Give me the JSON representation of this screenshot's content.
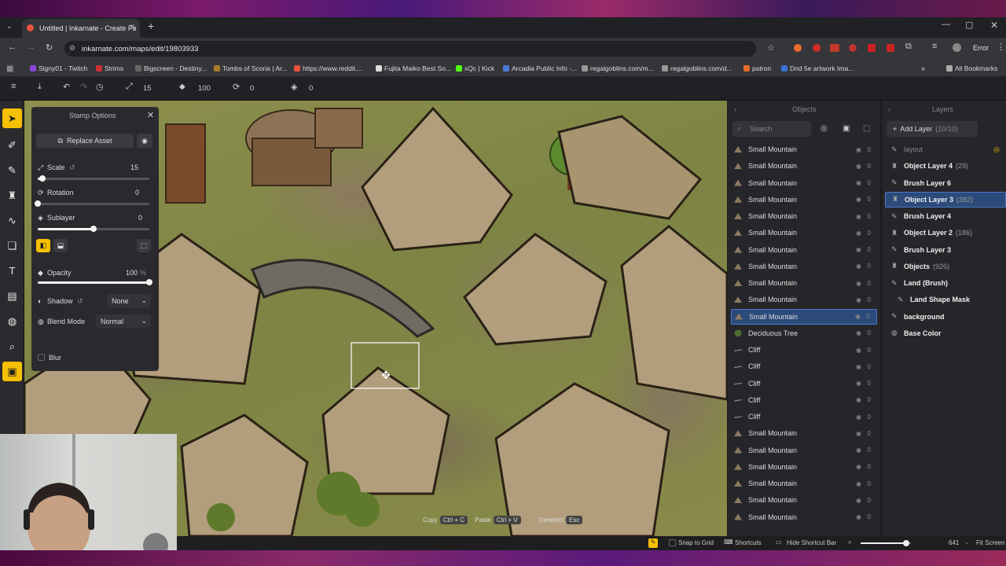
{
  "browser": {
    "tab_title": "Untitled | Inkarnate - Create Fa",
    "url": "inkarnate.com/maps/edit/19803933",
    "profile_label": "Error",
    "bookmarks": [
      "Signy01 - Twitch",
      "Strims",
      "Bigscreen - Destiny...",
      "Tombs of Scoria | Ar...",
      "https://www.reddit....",
      "Fujita Maiko Best So...",
      "xQc | Kick",
      "Arcadia Public Info -...",
      "regalgoblins.com/m...",
      "regalgoblins.com/d...",
      "patron",
      "Dnd 5e artwork Ima..."
    ],
    "all_bookmarks": "All Bookmarks"
  },
  "toolbar": {
    "size_value": "15",
    "opacity_value": "100",
    "rotation_value": "0",
    "layer_value": "0"
  },
  "stamp": {
    "title": "Stamp Options",
    "replace": "Replace Asset",
    "scale_label": "Scale",
    "scale_value": "15",
    "rotation_label": "Rotation",
    "rotation_value": "0",
    "sublayer_label": "Sublayer",
    "sublayer_value": "0",
    "opacity_label": "Opacity",
    "opacity_value": "100",
    "opacity_unit": "%",
    "shadow_label": "Shadow",
    "shadow_value": "None",
    "blend_label": "Blend Mode",
    "blend_value": "Normal",
    "blur_label": "Blur",
    "scale_level": 0.04,
    "rotation_level": 0.0,
    "sublayer_level": 0.5,
    "opacity_level": 1.0
  },
  "shortcuts": {
    "copy": "Copy",
    "copy_key": "Ctrl + C",
    "paste": "Paste",
    "paste_key": "Ctrl + V",
    "deselect": "Deselect",
    "deselect_key": "Esc"
  },
  "status": {
    "snap": "Snap to Grid",
    "shortcuts": "Shortcuts",
    "hide_bar": "Hide Shortcut Bar",
    "zoom": "641",
    "fit": "Fit Screen"
  },
  "objects": {
    "title": "Objects",
    "search_placeholder": "Search",
    "items": [
      {
        "name": "Small Mountain",
        "kind": "mountain",
        "value": "0"
      },
      {
        "name": "Small Mountain",
        "kind": "mountain",
        "value": "0"
      },
      {
        "name": "Small Mountain",
        "kind": "mountain",
        "value": "0"
      },
      {
        "name": "Small Mountain",
        "kind": "mountain",
        "value": "0"
      },
      {
        "name": "Small Mountain",
        "kind": "mountain",
        "value": "0"
      },
      {
        "name": "Small Mountain",
        "kind": "mountain",
        "value": "0"
      },
      {
        "name": "Small Mountain",
        "kind": "mountain",
        "value": "0"
      },
      {
        "name": "Small Mountain",
        "kind": "mountain",
        "value": "0"
      },
      {
        "name": "Small Mountain",
        "kind": "mountain",
        "value": "0"
      },
      {
        "name": "Small Mountain",
        "kind": "mountain",
        "value": "0"
      },
      {
        "name": "Small Mountain",
        "kind": "mountain",
        "value": "0",
        "selected": true
      },
      {
        "name": "Deciduous Tree",
        "kind": "tree",
        "value": "0"
      },
      {
        "name": "Cliff",
        "kind": "cliff",
        "value": "0"
      },
      {
        "name": "Cliff",
        "kind": "cliff",
        "value": "0"
      },
      {
        "name": "Cliff",
        "kind": "cliff",
        "value": "0"
      },
      {
        "name": "Cliff",
        "kind": "cliff",
        "value": "0"
      },
      {
        "name": "Cliff",
        "kind": "cliff",
        "value": "0"
      },
      {
        "name": "Small Mountain",
        "kind": "mountain",
        "value": "0"
      },
      {
        "name": "Small Mountain",
        "kind": "mountain",
        "value": "0"
      },
      {
        "name": "Small Mountain",
        "kind": "mountain",
        "value": "0"
      },
      {
        "name": "Small Mountain",
        "kind": "mountain",
        "value": "0"
      },
      {
        "name": "Small Mountain",
        "kind": "mountain",
        "value": "0"
      },
      {
        "name": "Small Mountain",
        "kind": "mountain",
        "value": "0"
      }
    ]
  },
  "layers": {
    "title": "Layers",
    "add": "Add Layer",
    "add_count": "(10/10)",
    "items": [
      {
        "name": "layout",
        "count": "",
        "icon": "brush",
        "dim": true
      },
      {
        "name": "Object Layer 4",
        "count": "(29)",
        "icon": "object"
      },
      {
        "name": "Brush Layer 6",
        "count": "",
        "icon": "brush"
      },
      {
        "name": "Object Layer 3",
        "count": "(382)",
        "icon": "object",
        "selected": true
      },
      {
        "name": "Brush Layer 4",
        "count": "",
        "icon": "brush"
      },
      {
        "name": "Object Layer 2",
        "count": "(186)",
        "icon": "object"
      },
      {
        "name": "Brush Layer 3",
        "count": "",
        "icon": "brush"
      },
      {
        "name": "Objects",
        "count": "(926)",
        "icon": "object"
      },
      {
        "name": "Land (Brush)",
        "count": "",
        "icon": "brush"
      },
      {
        "name": "Land Shape Mask",
        "count": "",
        "icon": "mask",
        "indent": true
      },
      {
        "name": "background",
        "count": "",
        "icon": "brush"
      },
      {
        "name": "Base Color",
        "count": "",
        "icon": "globe"
      }
    ]
  },
  "colors": {
    "accent": "#f5c000",
    "selection": "#2c4a7a",
    "panel": "#26262a"
  }
}
